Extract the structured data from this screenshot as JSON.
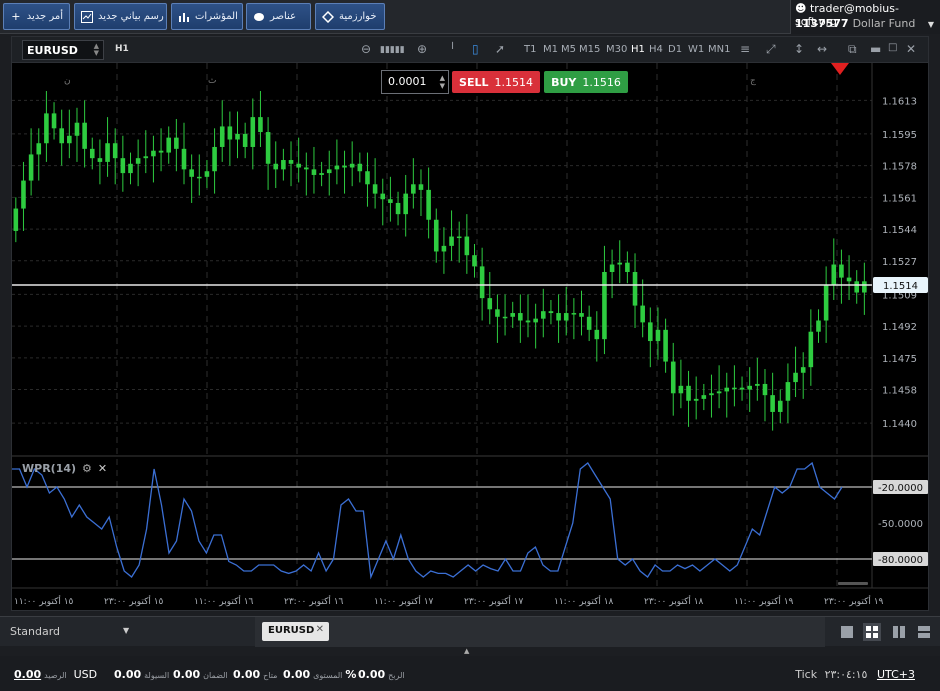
{
  "toolbar": {
    "new_order": "أمر جديد",
    "new_chart": "رسم بياني جديد",
    "indicators": "المؤشرات",
    "elements": "عناصر",
    "algorithms": "خوارزمية"
  },
  "account": {
    "user": "trader@mobius-soft.org",
    "id": "1137577",
    "fund": "Dollar Fund"
  },
  "chart": {
    "symbol": "EURUSD",
    "timeframe": "H1",
    "timeframes": [
      "T1",
      "M1",
      "M5",
      "M15",
      "M30",
      "H1",
      "H4",
      "D1",
      "W1",
      "MN1"
    ],
    "active_timeframe": "H1",
    "quantity": "0.0001",
    "sell_label": "SELL",
    "sell_price": "1.1514",
    "buy_label": "BUY",
    "buy_price": "1.1516",
    "indicator": "WPR(14)"
  },
  "chart_data": {
    "type": "candlestick",
    "series_name": "EURUSD H1",
    "y_ticks": [
      "1.1613",
      "1.1595",
      "1.1578",
      "1.1561",
      "1.1544",
      "1.1527",
      "1.1509",
      "1.1492",
      "1.1475",
      "1.1458",
      "1.1440"
    ],
    "ylim": [
      1.1424,
      1.1633
    ],
    "current_price": "1.1514",
    "day_labels": [
      "ن",
      "ث",
      "ج"
    ],
    "x_ticks": [
      "١٥ أكتوبر ١١:٠٠",
      "١٥ أكتوبر ٢٣:٠٠",
      "١٦ أكتوبر ١١:٠٠",
      "١٦ أكتوبر ٢٣:٠٠",
      "١٧ أكتوبر ١١:٠٠",
      "١٧ أكتوبر ٢٣:٠٠",
      "١٨ أكتوبر ١١:٠٠",
      "١٨ أكتوبر ٢٣:٠٠",
      "١٩ أكتوبر ١١:٠٠",
      "١٩ أكتوبر ٢٣:٠٠"
    ],
    "close": [
      1.1555,
      1.157,
      1.1584,
      1.159,
      1.1606,
      1.1598,
      1.159,
      1.1594,
      1.1601,
      1.1587,
      1.1582,
      1.158,
      1.159,
      1.1582,
      1.1574,
      1.1579,
      1.1582,
      1.1583,
      1.1586,
      1.1585,
      1.1593,
      1.1587,
      1.1576,
      1.1572,
      1.1572,
      1.1575,
      1.1588,
      1.1599,
      1.1592,
      1.1595,
      1.1588,
      1.1604,
      1.1596,
      1.1579,
      1.1576,
      1.1581,
      1.1579,
      1.1577,
      1.1576,
      1.1573,
      1.1574,
      1.1576,
      1.1578,
      1.1577,
      1.1579,
      1.1575,
      1.1568,
      1.1563,
      1.156,
      1.1558,
      1.1552,
      1.1563,
      1.1568,
      1.1565,
      1.1549,
      1.1532,
      1.1535,
      1.154,
      1.154,
      1.153,
      1.1524,
      1.1507,
      1.1501,
      1.1497,
      1.1497,
      1.1499,
      1.1495,
      1.1494,
      1.1496,
      1.15,
      1.1499,
      1.1495,
      1.1499,
      1.1499,
      1.1497,
      1.149,
      1.1485,
      1.1521,
      1.1525,
      1.1526,
      1.1521,
      1.1503,
      1.1494,
      1.1484,
      1.149,
      1.1473,
      1.1456,
      1.146,
      1.1452,
      1.1453,
      1.1455,
      1.1456,
      1.1457,
      1.1459,
      1.1459,
      1.1458,
      1.146,
      1.1461,
      1.1455,
      1.1446,
      1.1452,
      1.1462,
      1.1467,
      1.147,
      1.1489,
      1.1495,
      1.1514,
      1.1525,
      1.1518,
      1.1516,
      1.151,
      1.1516
    ],
    "wpr_ticks": [
      "-20.0000",
      "-50.0000",
      "-80.0000"
    ],
    "wpr_ylim": [
      -100,
      0
    ],
    "wpr": [
      -5,
      -5,
      -20,
      -5,
      -10,
      -25,
      -20,
      -30,
      -45,
      -35,
      -45,
      -50,
      -55,
      -45,
      -70,
      -90,
      -95,
      -85,
      -55,
      -5,
      -35,
      -75,
      -65,
      -30,
      -40,
      -65,
      -75,
      -60,
      -60,
      -82,
      -85,
      -90,
      -90,
      -85,
      -85,
      -85,
      -90,
      -92,
      -90,
      -85,
      -90,
      -75,
      -90,
      -80,
      -35,
      -30,
      -40,
      -40,
      -95,
      -80,
      -65,
      -80,
      -60,
      -80,
      -90,
      -95,
      -90,
      -92,
      -92,
      -95,
      -90,
      -85,
      -90,
      -85,
      -88,
      -90,
      -80,
      -90,
      -90,
      -75,
      -70,
      -85,
      -90,
      -90,
      -70,
      -50,
      -5,
      0,
      -10,
      -20,
      -30,
      -80,
      -85,
      -80,
      -90,
      -95,
      -85,
      -90,
      -90,
      -85,
      -88,
      -85,
      -90,
      -85,
      -80,
      -85,
      -90,
      -85,
      -70,
      -55,
      -60,
      -40,
      -20,
      -25,
      -20,
      -5,
      -5,
      0,
      -20,
      -25,
      -30,
      -20
    ]
  },
  "bottom": {
    "profile": "Standard",
    "tab_label": "EURUSD"
  },
  "status": {
    "balance_label": "الرصيد",
    "balance": "0.00",
    "currency": "USD",
    "equity_label": "السيولة",
    "equity": "0.00",
    "margin_label": "الضمان",
    "margin": "0.00",
    "free_label": "متاح",
    "free": "0.00",
    "level_label": "المستوى",
    "level": "0.00",
    "level_unit": "%",
    "profit_label": "الربح",
    "profit": "0.00",
    "tick_label": "Tick",
    "time": "٢٣:٠٤:١٥",
    "timezone": "UTC+3"
  },
  "colors": {
    "bull": "#2ecc40",
    "bear": "#2ecc40",
    "wpr_line": "#3b6fd4",
    "sell": "#d9303a",
    "buy": "#2f9e44"
  }
}
